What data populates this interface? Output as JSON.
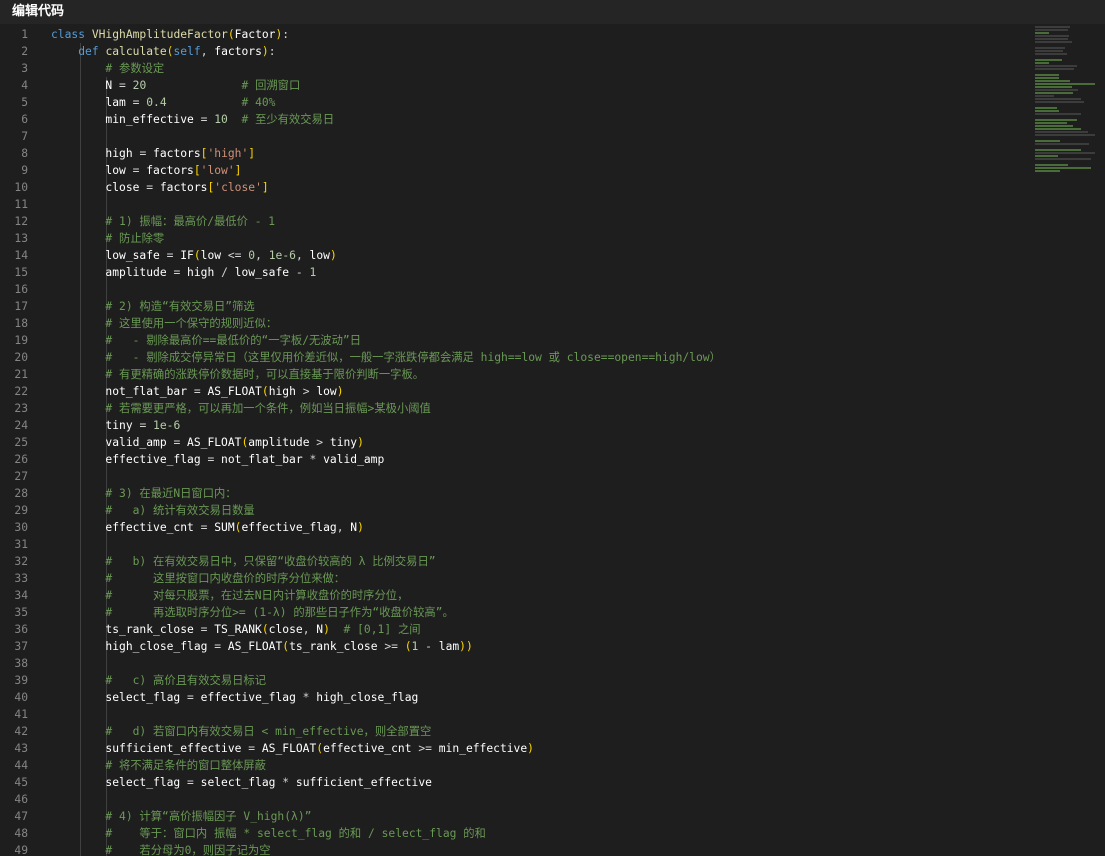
{
  "window": {
    "title": "编辑代码"
  },
  "editor": {
    "lines": [
      {
        "n": "1",
        "t": "class VHighAmplitudeFactor(Factor):"
      },
      {
        "n": "2",
        "t": "    def calculate(self, factors):"
      },
      {
        "n": "3",
        "t": "        # 参数设定"
      },
      {
        "n": "4",
        "t": "        N = 20              # 回溯窗口"
      },
      {
        "n": "5",
        "t": "        lam = 0.4           # 40%"
      },
      {
        "n": "6",
        "t": "        min_effective = 10  # 至少有效交易日"
      },
      {
        "n": "7",
        "t": ""
      },
      {
        "n": "8",
        "t": "        high = factors['high']"
      },
      {
        "n": "9",
        "t": "        low = factors['low']"
      },
      {
        "n": "10",
        "t": "        close = factors['close']"
      },
      {
        "n": "11",
        "t": ""
      },
      {
        "n": "12",
        "t": "        # 1) 振幅：最高价/最低价 - 1"
      },
      {
        "n": "13",
        "t": "        # 防止除零"
      },
      {
        "n": "14",
        "t": "        low_safe = IF(low <= 0, 1e-6, low)"
      },
      {
        "n": "15",
        "t": "        amplitude = high / low_safe - 1"
      },
      {
        "n": "16",
        "t": ""
      },
      {
        "n": "17",
        "t": "        # 2) 构造“有效交易日”筛选"
      },
      {
        "n": "18",
        "t": "        # 这里使用一个保守的规则近似："
      },
      {
        "n": "19",
        "t": "        #   - 剔除最高价==最低价的“一字板/无波动”日"
      },
      {
        "n": "20",
        "t": "        #   - 剔除成交停异常日（这里仅用价差近似，一般一字涨跌停都会满足 high==low 或 close==open==high/low）"
      },
      {
        "n": "21",
        "t": "        # 有更精确的涨跌停价数据时，可以直接基于限价判断一字板。"
      },
      {
        "n": "22",
        "t": "        not_flat_bar = AS_FLOAT(high > low)"
      },
      {
        "n": "23",
        "t": "        # 若需要更严格，可以再加一个条件，例如当日振幅>某极小阈值"
      },
      {
        "n": "24",
        "t": "        tiny = 1e-6"
      },
      {
        "n": "25",
        "t": "        valid_amp = AS_FLOAT(amplitude > tiny)"
      },
      {
        "n": "26",
        "t": "        effective_flag = not_flat_bar * valid_amp"
      },
      {
        "n": "27",
        "t": ""
      },
      {
        "n": "28",
        "t": "        # 3) 在最近N日窗口内："
      },
      {
        "n": "29",
        "t": "        #   a) 统计有效交易日数量"
      },
      {
        "n": "30",
        "t": "        effective_cnt = SUM(effective_flag, N)"
      },
      {
        "n": "31",
        "t": ""
      },
      {
        "n": "32",
        "t": "        #   b) 在有效交易日中，只保留“收盘价较高的 λ 比例交易日”"
      },
      {
        "n": "33",
        "t": "        #      这里按窗口内收盘价的时序分位来做："
      },
      {
        "n": "34",
        "t": "        #      对每只股票，在过去N日内计算收盘价的时序分位，"
      },
      {
        "n": "35",
        "t": "        #      再选取时序分位>= (1-λ) 的那些日子作为“收盘价较高”。"
      },
      {
        "n": "36",
        "t": "        ts_rank_close = TS_RANK(close, N)  # [0,1] 之间"
      },
      {
        "n": "37",
        "t": "        high_close_flag = AS_FLOAT(ts_rank_close >= (1 - lam))"
      },
      {
        "n": "38",
        "t": ""
      },
      {
        "n": "39",
        "t": "        #   c) 高价且有效交易日标记"
      },
      {
        "n": "40",
        "t": "        select_flag = effective_flag * high_close_flag"
      },
      {
        "n": "41",
        "t": ""
      },
      {
        "n": "42",
        "t": "        #   d) 若窗口内有效交易日 < min_effective，则全部置空"
      },
      {
        "n": "43",
        "t": "        sufficient_effective = AS_FLOAT(effective_cnt >= min_effective)"
      },
      {
        "n": "44",
        "t": "        # 将不满足条件的窗口整体屏蔽"
      },
      {
        "n": "45",
        "t": "        select_flag = select_flag * sufficient_effective"
      },
      {
        "n": "46",
        "t": ""
      },
      {
        "n": "47",
        "t": "        # 4) 计算“高价振幅因子 V_high(λ)”"
      },
      {
        "n": "48",
        "t": "        #    等于：窗口内 振幅 * select_flag 的和 / select_flag 的和"
      },
      {
        "n": "49",
        "t": "        #    若分母为0，则因子记为空"
      }
    ]
  },
  "colors": {
    "background": "#1e1e1e",
    "line_number": "#858585",
    "keyword": "#569cd6",
    "function": "#dcdcaa",
    "string": "#ce9178",
    "number": "#b5cea8",
    "comment": "#6a9955"
  }
}
